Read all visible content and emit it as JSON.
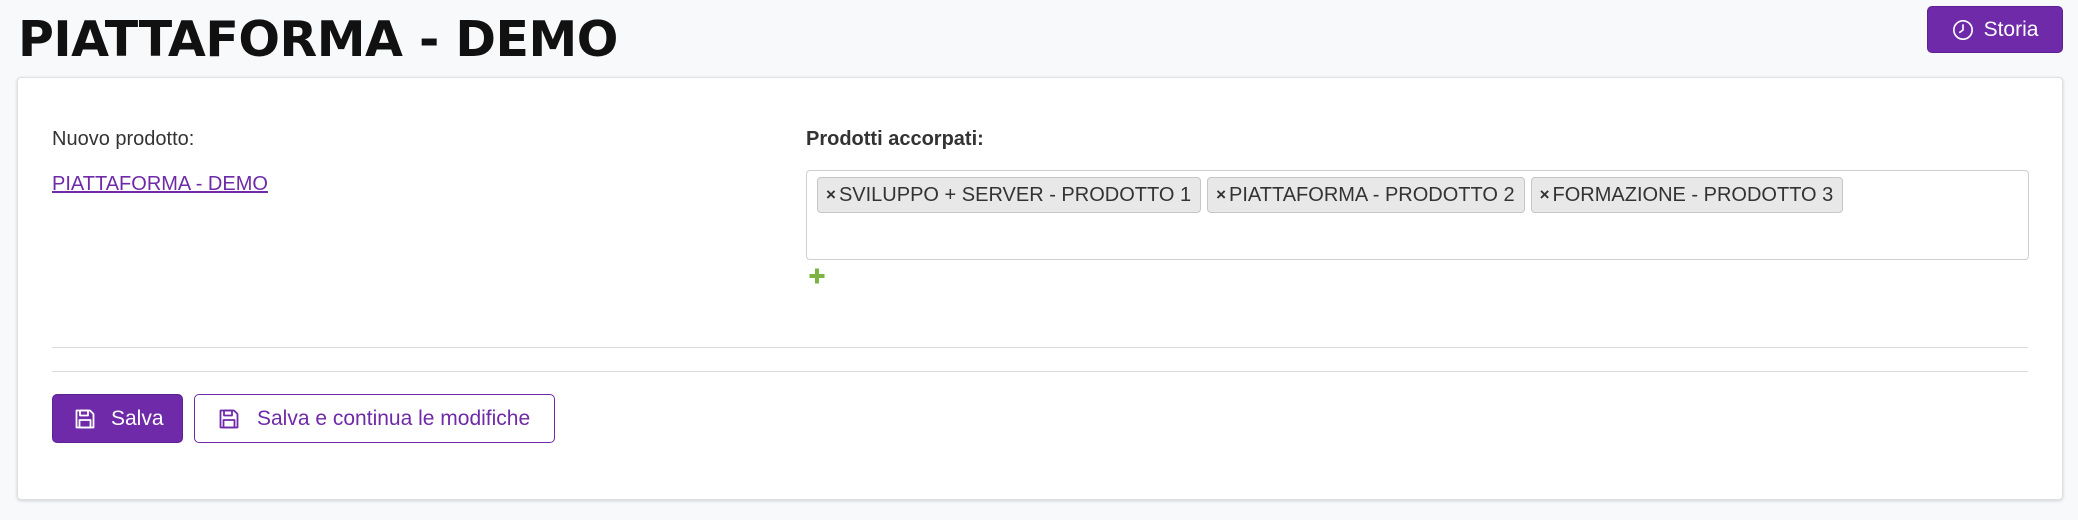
{
  "header": {
    "title": "PIATTAFORMA - DEMO",
    "history_button": {
      "label": "Storia",
      "icon": "clock-icon"
    }
  },
  "form": {
    "new_product": {
      "label": "Nuovo prodotto:",
      "link_text": "PIATTAFORMA - DEMO"
    },
    "merged_products": {
      "label": "Prodotti accorpati:",
      "remove_symbol": "×",
      "tags": [
        {
          "label": "SVILUPPO + SERVER - PRODOTTO 1"
        },
        {
          "label": "PIATTAFORMA - PRODOTTO 2"
        },
        {
          "label": "FORMAZIONE - PRODOTTO 3"
        }
      ],
      "add_icon": "plus-icon"
    }
  },
  "actions": {
    "save_label": "Salva",
    "save_continue_label": "Salva e continua le modifiche",
    "save_icon": "floppy-disk-icon"
  },
  "colors": {
    "accent": "#6e2aa8",
    "add_green": "#7cb342",
    "background": "#f8f9fa"
  }
}
